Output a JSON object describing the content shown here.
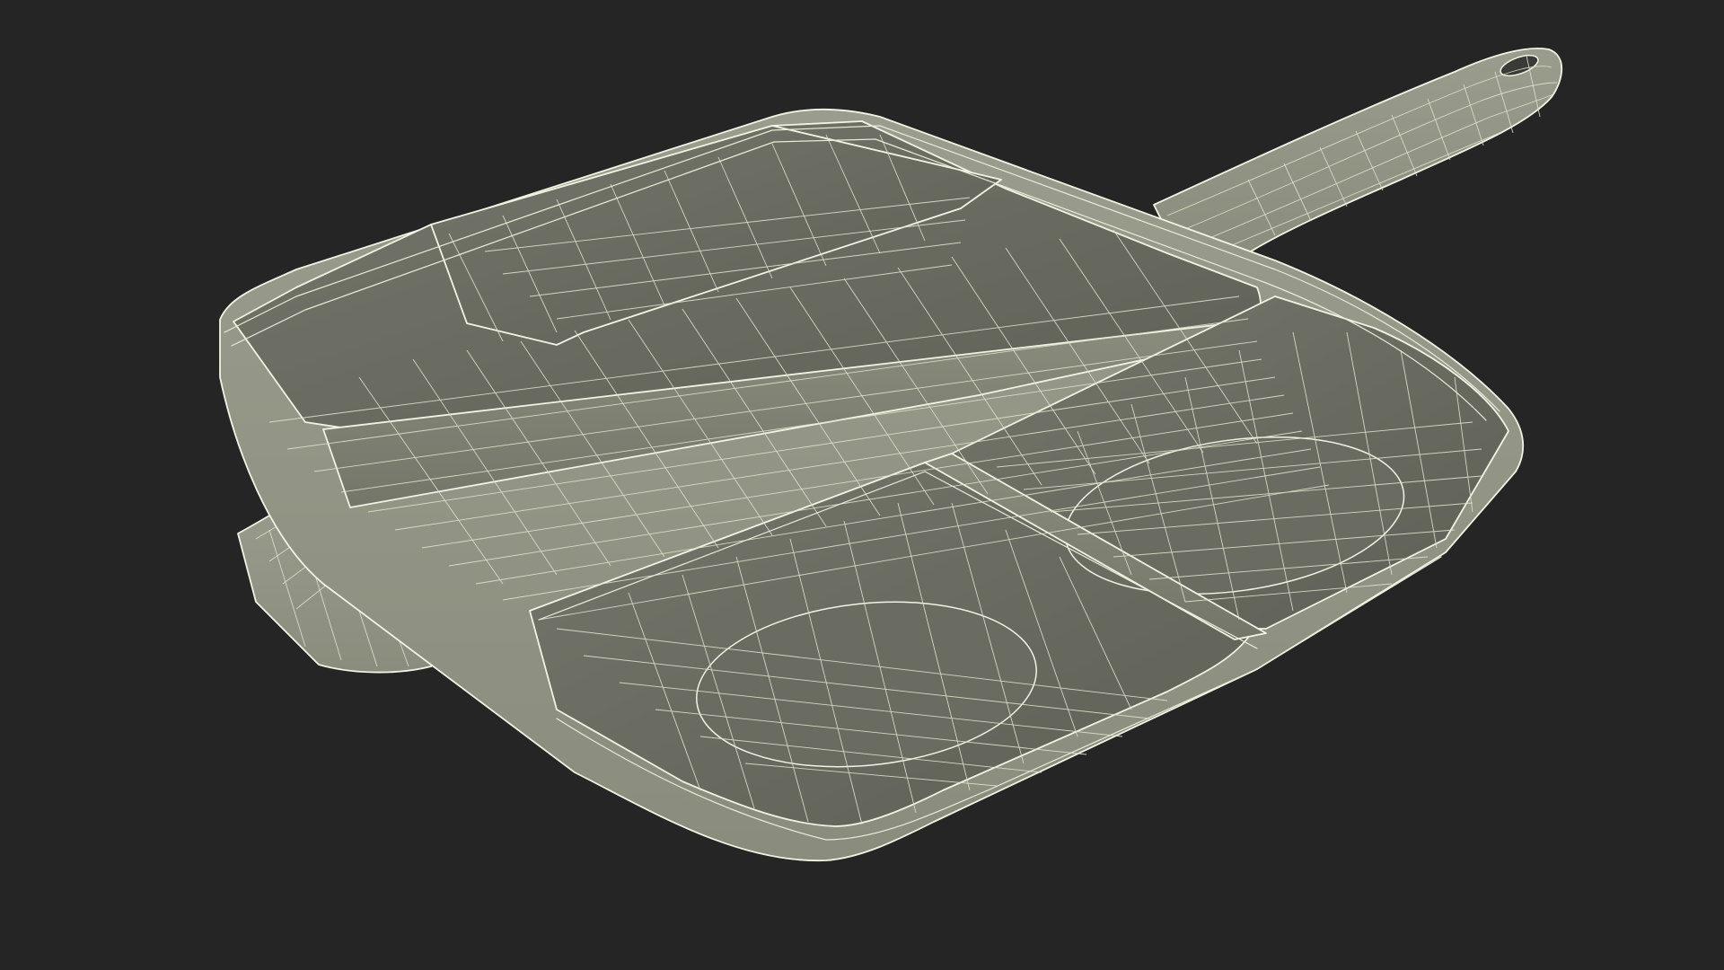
{
  "scene": {
    "subject": "divided-square-frying-pan-wireframe",
    "view": "perspective",
    "compartments": 3,
    "colors": {
      "background": "#252525",
      "surface_light": "#8a8c7d",
      "surface_mid": "#74766a",
      "surface_dark": "#5e6057",
      "rim": "#9a9c8d",
      "wireframe": "#e9ecd9"
    }
  }
}
